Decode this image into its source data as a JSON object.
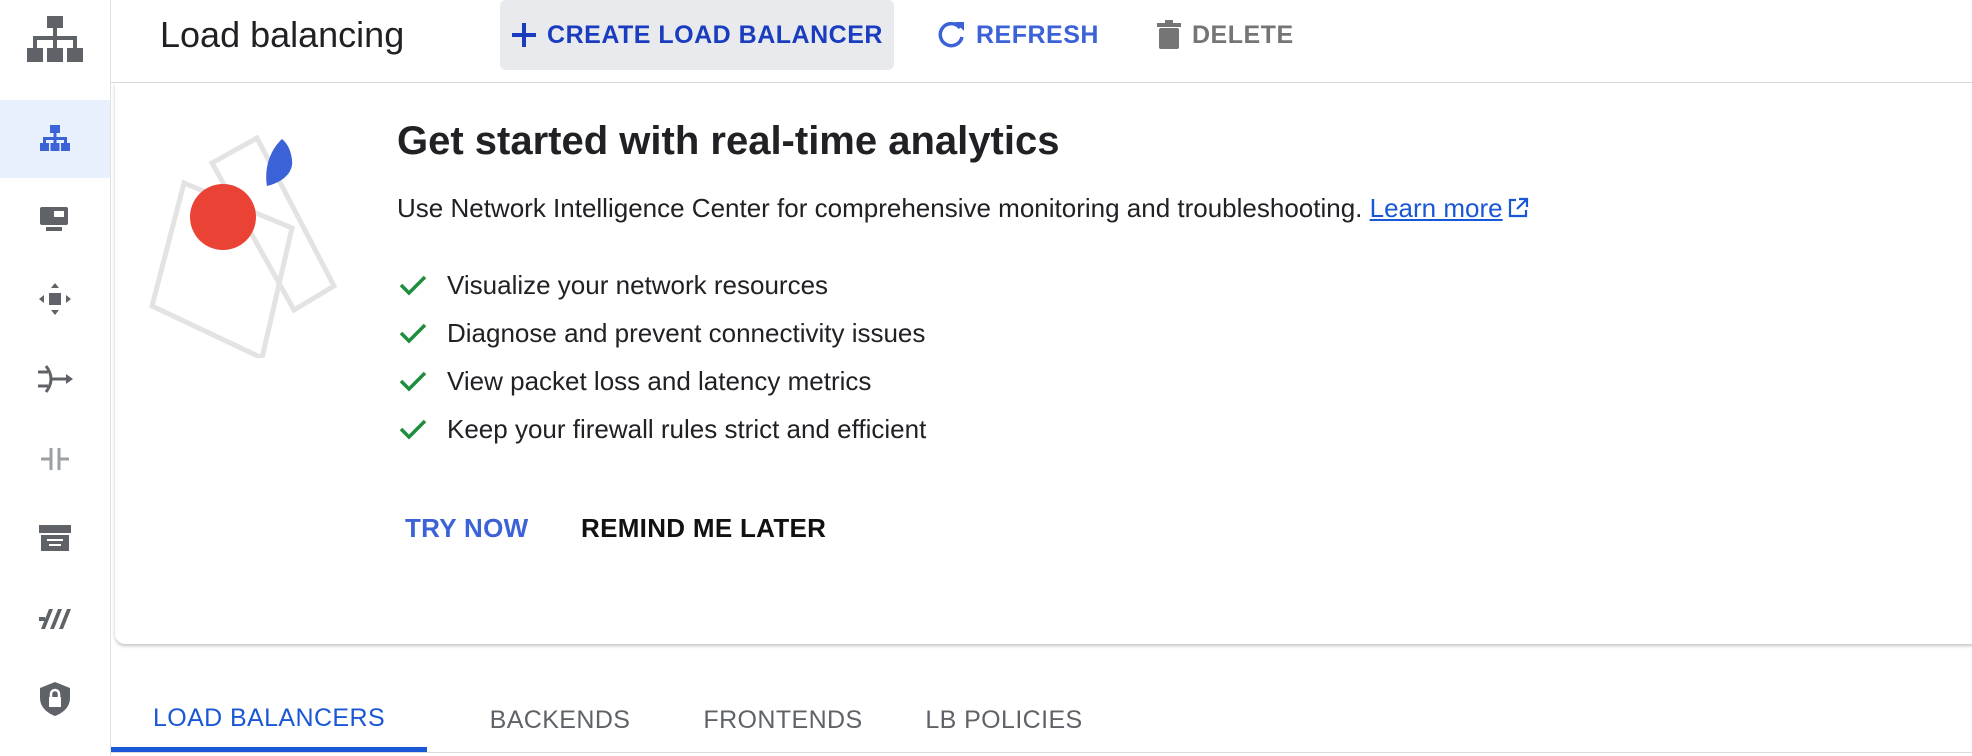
{
  "colors": {
    "accent": "#1a57d6",
    "active_rail_bg": "#e8f0fe",
    "check_green": "#1e8e3e",
    "illus_red": "#ea4335",
    "illus_blue": "#3b62d6"
  },
  "rail": {
    "logo_icon": "network-hierarchy-icon",
    "items": [
      {
        "icon": "load-balancing-icon",
        "active": true
      },
      {
        "icon": "cloud-cdn-icon"
      },
      {
        "icon": "traffic-director-icon"
      },
      {
        "icon": "cloud-nat-icon"
      },
      {
        "icon": "network-connectivity-icon"
      },
      {
        "icon": "cloud-dns-icon"
      },
      {
        "icon": "network-tiers-icon"
      },
      {
        "icon": "security-shield-icon"
      }
    ]
  },
  "header": {
    "title": "Load balancing",
    "create_label": "CREATE LOAD BALANCER",
    "refresh_label": "REFRESH",
    "delete_label": "DELETE"
  },
  "banner": {
    "title": "Get started with real-time analytics",
    "description": "Use Network Intelligence Center for comprehensive monitoring and troubleshooting.",
    "learn_more": "Learn more",
    "features": [
      "Visualize your network resources",
      "Diagnose and prevent connectivity issues",
      "View packet loss and latency metrics",
      "Keep your firewall rules strict and efficient"
    ],
    "try_now": "TRY NOW",
    "remind_later": "REMIND ME LATER"
  },
  "tabs": [
    {
      "label": "LOAD BALANCERS",
      "active": true
    },
    {
      "label": "BACKENDS"
    },
    {
      "label": "FRONTENDS"
    },
    {
      "label": "LB POLICIES"
    }
  ]
}
